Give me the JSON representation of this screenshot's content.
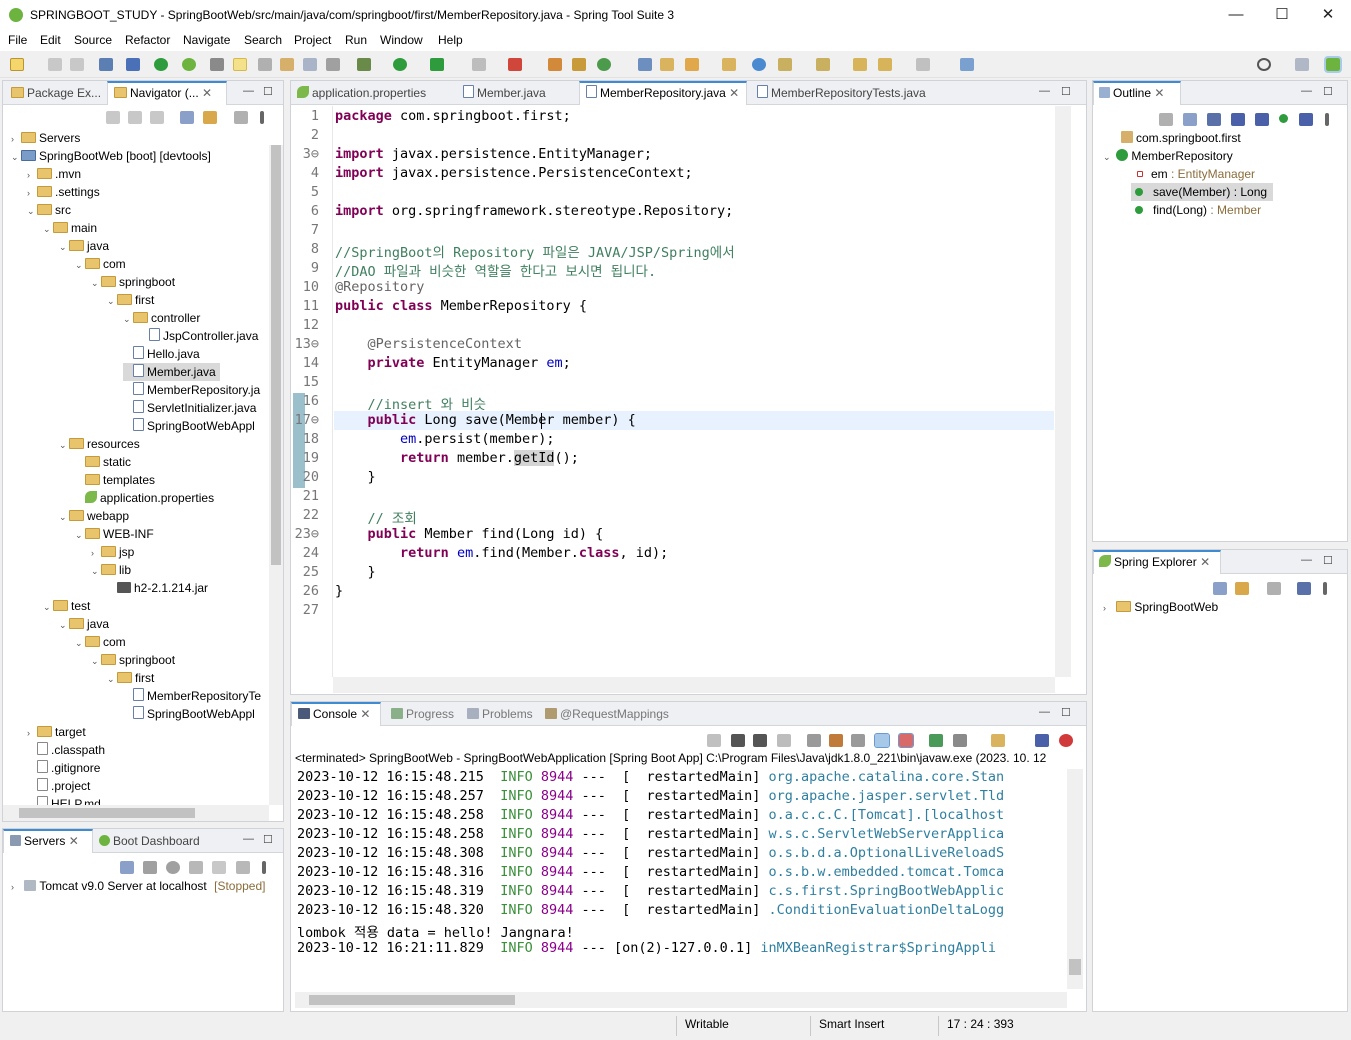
{
  "window": {
    "title": "SPRINGBOOT_STUDY - SpringBootWeb/src/main/java/com/springboot/first/MemberRepository.java - Spring Tool Suite 3",
    "minimize": "—",
    "maximize": "☐",
    "close": "✕"
  },
  "menu": [
    "File",
    "Edit",
    "Source",
    "Refactor",
    "Navigate",
    "Search",
    "Project",
    "Run",
    "Window",
    "Help"
  ],
  "left_tabs": {
    "package_explorer": "Package Ex...",
    "navigator": "Navigator (..."
  },
  "tree": [
    {
      "label": "Servers",
      "icon": "folder",
      "level": 0,
      "tw": "›"
    },
    {
      "label": "SpringBootWeb [boot] [devtools]",
      "icon": "project",
      "level": 0,
      "tw": "⌄"
    },
    {
      "label": ".mvn",
      "icon": "folder",
      "level": 1,
      "tw": "›"
    },
    {
      "label": ".settings",
      "icon": "folder",
      "level": 1,
      "tw": "›"
    },
    {
      "label": "src",
      "icon": "folder",
      "level": 1,
      "tw": "⌄"
    },
    {
      "label": "main",
      "icon": "folder",
      "level": 2,
      "tw": "⌄"
    },
    {
      "label": "java",
      "icon": "folder",
      "level": 3,
      "tw": "⌄"
    },
    {
      "label": "com",
      "icon": "folder",
      "level": 4,
      "tw": "⌄"
    },
    {
      "label": "springboot",
      "icon": "folder",
      "level": 5,
      "tw": "⌄"
    },
    {
      "label": "first",
      "icon": "folder",
      "level": 6,
      "tw": "⌄"
    },
    {
      "label": "controller",
      "icon": "folder",
      "level": 7,
      "tw": "⌄"
    },
    {
      "label": "JspController.java",
      "icon": "java",
      "level": 8,
      "tw": ""
    },
    {
      "label": "Hello.java",
      "icon": "java",
      "level": 7,
      "tw": ""
    },
    {
      "label": "Member.java",
      "icon": "java",
      "level": 7,
      "tw": "",
      "selected": true
    },
    {
      "label": "MemberRepository.ja",
      "icon": "java",
      "level": 7,
      "tw": ""
    },
    {
      "label": "ServletInitializer.java",
      "icon": "java",
      "level": 7,
      "tw": ""
    },
    {
      "label": "SpringBootWebAppl",
      "icon": "java",
      "level": 7,
      "tw": ""
    },
    {
      "label": "resources",
      "icon": "folder",
      "level": 3,
      "tw": "⌄"
    },
    {
      "label": "static",
      "icon": "folder",
      "level": 4,
      "tw": ""
    },
    {
      "label": "templates",
      "icon": "folder",
      "level": 4,
      "tw": ""
    },
    {
      "label": "application.properties",
      "icon": "leaf",
      "level": 4,
      "tw": ""
    },
    {
      "label": "webapp",
      "icon": "folder",
      "level": 3,
      "tw": "⌄"
    },
    {
      "label": "WEB-INF",
      "icon": "folder",
      "level": 4,
      "tw": "⌄"
    },
    {
      "label": "jsp",
      "icon": "folder",
      "level": 5,
      "tw": "›"
    },
    {
      "label": "lib",
      "icon": "folder",
      "level": 5,
      "tw": "⌄"
    },
    {
      "label": "h2-2.1.214.jar",
      "icon": "jar",
      "level": 6,
      "tw": ""
    },
    {
      "label": "test",
      "icon": "folder",
      "level": 2,
      "tw": "⌄"
    },
    {
      "label": "java",
      "icon": "folder",
      "level": 3,
      "tw": "⌄"
    },
    {
      "label": "com",
      "icon": "folder",
      "level": 4,
      "tw": "⌄"
    },
    {
      "label": "springboot",
      "icon": "folder",
      "level": 5,
      "tw": "⌄"
    },
    {
      "label": "first",
      "icon": "folder",
      "level": 6,
      "tw": "⌄"
    },
    {
      "label": "MemberRepositoryTe",
      "icon": "java",
      "level": 7,
      "tw": ""
    },
    {
      "label": "SpringBootWebAppl",
      "icon": "java",
      "level": 7,
      "tw": ""
    },
    {
      "label": "target",
      "icon": "folder",
      "level": 1,
      "tw": "›"
    },
    {
      "label": ".classpath",
      "icon": "x",
      "level": 1,
      "tw": ""
    },
    {
      "label": ".gitignore",
      "icon": "x",
      "level": 1,
      "tw": ""
    },
    {
      "label": ".project",
      "icon": "x",
      "level": 1,
      "tw": ""
    },
    {
      "label": "HELP.md",
      "icon": "x",
      "level": 1,
      "tw": ""
    }
  ],
  "servers_panel": {
    "tab_servers": "Servers",
    "tab_boot": "Boot Dashboard",
    "server_name": "Tomcat v9.0 Server at localhost",
    "server_status": "[Stopped]"
  },
  "editor_tabs": [
    {
      "label": "application.properties"
    },
    {
      "label": "Member.java"
    },
    {
      "label": "MemberRepository.java",
      "active": true
    },
    {
      "label": "MemberRepositoryTests.java"
    }
  ],
  "code": [
    {
      "n": "1",
      "html": "<span class=\"kw\">package</span> com.springboot.first;"
    },
    {
      "n": "2",
      "html": ""
    },
    {
      "n": "3⊖",
      "html": "<span class=\"kw\">import</span> javax.persistence.EntityManager;"
    },
    {
      "n": "4",
      "html": "<span class=\"kw\">import</span> javax.persistence.PersistenceContext;"
    },
    {
      "n": "5",
      "html": ""
    },
    {
      "n": "6",
      "html": "<span class=\"kw\">import</span> org.springframework.stereotype.Repository;"
    },
    {
      "n": "7",
      "html": ""
    },
    {
      "n": "8",
      "html": "<span class=\"cm\">//SpringBoot의 Repository 파일은 JAVA/JSP/Spring에서</span>"
    },
    {
      "n": "9",
      "html": "<span class=\"cm\">//DAO 파일과 비슷한 역할을 한다고 보시면 됩니다.</span>"
    },
    {
      "n": "10",
      "html": "<span class=\"an\">@Repository</span>"
    },
    {
      "n": "11",
      "html": "<span class=\"kw\">public class</span> MemberRepository {"
    },
    {
      "n": "12",
      "html": ""
    },
    {
      "n": "13⊖",
      "html": "    <span class=\"an\">@PersistenceContext</span>"
    },
    {
      "n": "14",
      "html": "    <span class=\"kw\">private</span> EntityManager <span class=\"fld\">em</span>;"
    },
    {
      "n": "15",
      "html": ""
    },
    {
      "n": "16",
      "html": "    <span class=\"cm\">//insert 와 비슷</span>"
    },
    {
      "n": "17⊖",
      "html": "    <span class=\"kw\">public</span> Long save(Member member) {"
    },
    {
      "n": "18",
      "html": "        <span class=\"fld\">em</span>.persist(member);"
    },
    {
      "n": "19",
      "html": "        <span class=\"kw\">return</span> member.<span style=\"background:#d4d4d4\">getId</span>();"
    },
    {
      "n": "20",
      "html": "    }"
    },
    {
      "n": "21",
      "html": ""
    },
    {
      "n": "22",
      "html": "    <span class=\"cm\">// 조회</span>"
    },
    {
      "n": "23⊖",
      "html": "    <span class=\"kw\">public</span> Member find(Long id) {"
    },
    {
      "n": "24",
      "html": "        <span class=\"kw\">return</span> <span class=\"fld\">em</span>.find(Member.<span class=\"kw\">class</span>, id);"
    },
    {
      "n": "25",
      "html": "    }"
    },
    {
      "n": "26",
      "html": "}"
    },
    {
      "n": "27",
      "html": ""
    }
  ],
  "outline": {
    "tab": "Outline",
    "package": "com.springboot.first",
    "class": "MemberRepository",
    "members": [
      {
        "name": "em",
        "type": " : EntityManager",
        "kind": "field"
      },
      {
        "name": "save(Member)",
        "type": " : Long",
        "kind": "method",
        "selected": true
      },
      {
        "name": "find(Long)",
        "type": " : Member",
        "kind": "method"
      }
    ]
  },
  "spring_explorer": {
    "tab": "Spring Explorer",
    "item": "SpringBootWeb"
  },
  "console": {
    "tabs": [
      {
        "label": "Console",
        "active": true
      },
      {
        "label": "Progress"
      },
      {
        "label": "Problems"
      },
      {
        "label": "@RequestMappings"
      }
    ],
    "header": "<terminated> SpringBootWeb - SpringBootWebApplication [Spring Boot App] C:\\Program Files\\Java\\jdk1.8.0_221\\bin\\javaw.exe  (2023. 10. 12",
    "lines": [
      {
        "ts": "2023-10-12 16:15:48.215",
        "lvl": "INFO",
        "pid": "8944",
        "thr": "---  [  restartedMain]",
        "lg": "org.apache.catalina.core.Stan"
      },
      {
        "ts": "2023-10-12 16:15:48.257",
        "lvl": "INFO",
        "pid": "8944",
        "thr": "---  [  restartedMain]",
        "lg": "org.apache.jasper.servlet.Tld"
      },
      {
        "ts": "2023-10-12 16:15:48.258",
        "lvl": "INFO",
        "pid": "8944",
        "thr": "---  [  restartedMain]",
        "lg": "o.a.c.c.C.[Tomcat].[localhost"
      },
      {
        "ts": "2023-10-12 16:15:48.258",
        "lvl": "INFO",
        "pid": "8944",
        "thr": "---  [  restartedMain]",
        "lg": "w.s.c.ServletWebServerApplica"
      },
      {
        "ts": "2023-10-12 16:15:48.308",
        "lvl": "INFO",
        "pid": "8944",
        "thr": "---  [  restartedMain]",
        "lg": "o.s.b.d.a.OptionalLiveReloadS"
      },
      {
        "ts": "2023-10-12 16:15:48.316",
        "lvl": "INFO",
        "pid": "8944",
        "thr": "---  [  restartedMain]",
        "lg": "o.s.b.w.embedded.tomcat.Tomca"
      },
      {
        "ts": "2023-10-12 16:15:48.319",
        "lvl": "INFO",
        "pid": "8944",
        "thr": "---  [  restartedMain]",
        "lg": "c.s.first.SpringBootWebApplic"
      },
      {
        "ts": "2023-10-12 16:15:48.320",
        "lvl": "INFO",
        "pid": "8944",
        "thr": "---  [  restartedMain]",
        "lg": ".ConditionEvaluationDeltaLogg"
      },
      {
        "plain": "lombok 적용 data = hello! Jangnara!"
      },
      {
        "ts": "2023-10-12 16:21:11.829",
        "lvl": "INFO",
        "pid": "8944",
        "thr": "--- [on(2)-127.0.0.1]",
        "lg": "inMXBeanRegistrar$SpringAppli"
      }
    ]
  },
  "status": {
    "writable": "Writable",
    "insert": "Smart Insert",
    "position": "17 : 24 : 393"
  },
  "colors": {
    "accent": "#3f8bd3",
    "keyword": "#7f0055",
    "comment": "#3f7f5f",
    "field": "#0000c0",
    "spring": "#6db33f"
  }
}
